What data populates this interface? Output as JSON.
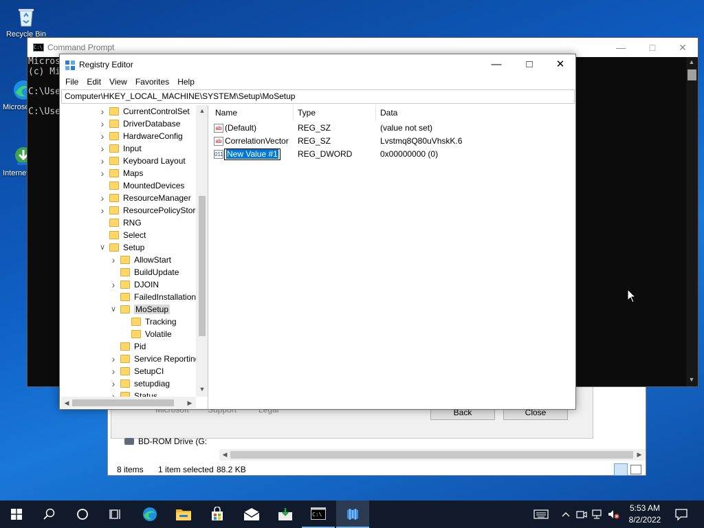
{
  "desktop": {
    "icons": [
      {
        "label": "Recycle Bin"
      },
      {
        "label": "Microsoft Edge"
      },
      {
        "label": "Internet Download Manager"
      }
    ]
  },
  "explorer": {
    "links": [
      "Microsoft",
      "Support",
      "Legal"
    ],
    "back_label": "Back",
    "close_label": "Close",
    "drive_label": "BD-ROM Drive (G:",
    "status": {
      "items": "8 items",
      "selected": "1 item selected",
      "size": "88.2 KB"
    }
  },
  "cmd": {
    "title": "Command Prompt",
    "lines": [
      "Micros",
      "(c) Mi",
      "",
      "C:\\Use",
      "",
      "C:\\Use"
    ]
  },
  "regedit": {
    "title": "Registry Editor",
    "menu": [
      "File",
      "Edit",
      "View",
      "Favorites",
      "Help"
    ],
    "address": "Computer\\HKEY_LOCAL_MACHINE\\SYSTEM\\Setup\\MoSetup",
    "tree": [
      {
        "label": "CurrentControlSet",
        "level": 0,
        "exp": "collapsed"
      },
      {
        "label": "DriverDatabase",
        "level": 0,
        "exp": "collapsed"
      },
      {
        "label": "HardwareConfig",
        "level": 0,
        "exp": "collapsed"
      },
      {
        "label": "Input",
        "level": 0,
        "exp": "collapsed"
      },
      {
        "label": "Keyboard Layout",
        "level": 0,
        "exp": "collapsed"
      },
      {
        "label": "Maps",
        "level": 0,
        "exp": "collapsed"
      },
      {
        "label": "MountedDevices",
        "level": 0,
        "exp": "none"
      },
      {
        "label": "ResourceManager",
        "level": 0,
        "exp": "collapsed"
      },
      {
        "label": "ResourcePolicyStore",
        "level": 0,
        "exp": "collapsed"
      },
      {
        "label": "RNG",
        "level": 0,
        "exp": "none"
      },
      {
        "label": "Select",
        "level": 0,
        "exp": "none"
      },
      {
        "label": "Setup",
        "level": 0,
        "exp": "expanded"
      },
      {
        "label": "AllowStart",
        "level": 1,
        "exp": "collapsed"
      },
      {
        "label": "BuildUpdate",
        "level": 1,
        "exp": "none"
      },
      {
        "label": "DJOIN",
        "level": 1,
        "exp": "collapsed"
      },
      {
        "label": "FailedInstallations",
        "level": 1,
        "exp": "none"
      },
      {
        "label": "MoSetup",
        "level": 1,
        "exp": "expanded",
        "selected": true
      },
      {
        "label": "Tracking",
        "level": 2,
        "exp": "none"
      },
      {
        "label": "Volatile",
        "level": 2,
        "exp": "none"
      },
      {
        "label": "Pid",
        "level": 1,
        "exp": "none"
      },
      {
        "label": "Service Reporting",
        "level": 1,
        "exp": "collapsed"
      },
      {
        "label": "SetupCI",
        "level": 1,
        "exp": "collapsed"
      },
      {
        "label": "setupdiag",
        "level": 1,
        "exp": "collapsed"
      },
      {
        "label": "Status",
        "level": 1,
        "exp": "collapsed"
      }
    ],
    "columns": {
      "name": "Name",
      "type": "Type",
      "data": "Data"
    },
    "values": [
      {
        "name": "(Default)",
        "type": "REG_SZ",
        "data": "(value not set)",
        "icon": "ab"
      },
      {
        "name": "CorrelationVector",
        "type": "REG_SZ",
        "data": "Lvstmq8Q80uVhskK.6",
        "icon": "ab"
      },
      {
        "name": "New Value #1",
        "type": "REG_DWORD",
        "data": "0x00000000 (0)",
        "icon": "bin",
        "editing": true
      }
    ]
  },
  "taskbar": {
    "time": "5:53 AM",
    "date": "8/2/2022"
  },
  "colors": {
    "selection": "#0078d7",
    "taskbar": "#101a2a",
    "folder": "#ffd766"
  }
}
